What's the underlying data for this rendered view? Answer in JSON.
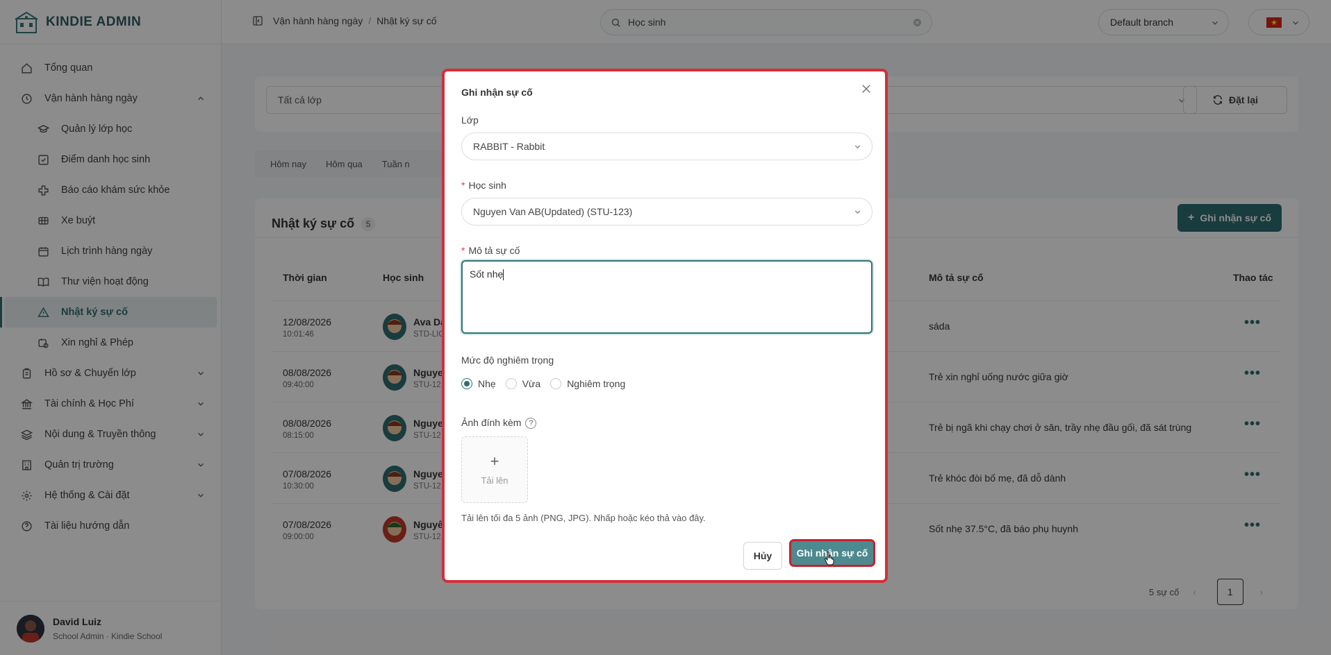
{
  "brand": {
    "name": "KINDIE ADMIN"
  },
  "sidebar": {
    "items": [
      {
        "label": "Tổng quan"
      },
      {
        "label": "Vận hành hàng ngày"
      },
      {
        "label": "Quản lý lớp học"
      },
      {
        "label": "Điểm danh học sinh"
      },
      {
        "label": "Báo cáo khám sức khỏe"
      },
      {
        "label": "Xe buýt"
      },
      {
        "label": "Lịch trình hàng ngày"
      },
      {
        "label": "Thư viện hoạt động"
      },
      {
        "label": "Nhật ký sự cố"
      },
      {
        "label": "Xin nghỉ & Phép"
      },
      {
        "label": "Hồ sơ & Chuyển lớp"
      },
      {
        "label": "Tài chính & Học Phí"
      },
      {
        "label": "Nội dung & Truyền thông"
      },
      {
        "label": "Quản trị trường"
      },
      {
        "label": "Hệ thống & Cài đặt"
      },
      {
        "label": "Tài liệu hướng dẫn"
      }
    ]
  },
  "user": {
    "name": "David Luiz",
    "role": "School Admin · Kindie School"
  },
  "header": {
    "breadcrumb": [
      "Vận hành hàng ngày",
      "Nhật ký sự cố"
    ],
    "search_value": "Học sinh",
    "branch": "Default branch"
  },
  "filters": {
    "class_placeholder": "Tất cả lớp",
    "reset_label": "Đặt lại"
  },
  "tabs": [
    "Hôm nay",
    "Hôm qua",
    "Tuần n"
  ],
  "table": {
    "title": "Nhật ký sự cố",
    "count": "5",
    "add_label": "Ghi nhận sự cố",
    "columns": {
      "time": "Thời gian",
      "student": "Học sinh",
      "desc": "Mô tả sự cố",
      "actions": "Thao tác"
    },
    "rows": [
      {
        "date": "12/08/2026",
        "time": "10:01:46",
        "name": "Ava Da",
        "code": "STD-LIO",
        "desc": "sáda"
      },
      {
        "date": "08/08/2026",
        "time": "09:40:00",
        "name": "Nguye",
        "code": "STU-12",
        "desc": "Trẻ xin nghỉ uống nước giữa giờ"
      },
      {
        "date": "08/08/2026",
        "time": "08:15:00",
        "name": "Nguye",
        "code": "STU-12",
        "desc": "Trẻ bị ngã khi chạy chơi ở sân, trầy nhẹ đầu gối, đã sát trùng"
      },
      {
        "date": "07/08/2026",
        "time": "10:30:00",
        "name": "Nguye",
        "code": "STU-12",
        "desc": "Trẻ khóc đòi bố mẹ, đã dỗ dành"
      },
      {
        "date": "07/08/2026",
        "time": "09:00:00",
        "name": "Nguyê",
        "code": "STU-12",
        "desc": "Sốt nhẹ 37.5°C, đã báo phụ huynh"
      }
    ],
    "total_label": "5 sự cố",
    "page": "1"
  },
  "modal": {
    "title": "Ghi nhận sự cố",
    "class_label": "Lớp",
    "class_value": "RABBIT - Rabbit",
    "student_label": "Học sinh",
    "student_value": "Nguyen Van AB(Updated) (STU-123)",
    "desc_label": "Mô tả sự cố",
    "desc_value": "Sốt nhẹ",
    "severity_label": "Mức độ nghiêm trọng",
    "severity_options": [
      "Nhẹ",
      "Vừa",
      "Nghiêm trọng"
    ],
    "attach_label": "Ảnh đính kèm",
    "upload_label": "Tải lên",
    "upload_hint": "Tải lên tối đa 5 ảnh (PNG, JPG). Nhấp hoặc kéo thả vào đây.",
    "cancel_label": "Hủy",
    "submit_label": "Ghi nhận sự cố"
  },
  "colors": {
    "accent": "#2e6e72",
    "highlight": "#d32f3b"
  }
}
